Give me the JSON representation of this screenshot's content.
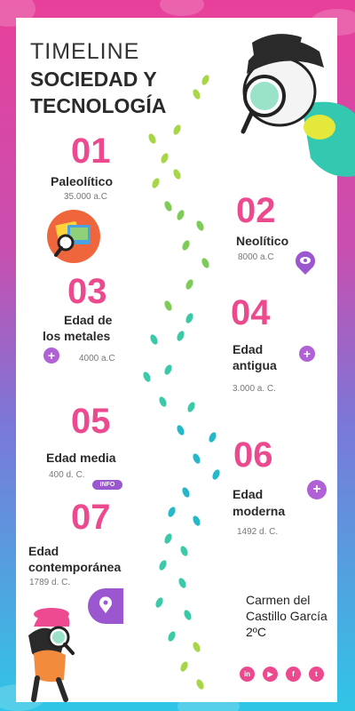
{
  "title": {
    "line1": "TIMELINE",
    "line2": "SOCIEDAD Y",
    "line3": "TECNOLOGÍA"
  },
  "items": [
    {
      "number": "01",
      "era": "Paleolítico",
      "date": "35.000 a.C"
    },
    {
      "number": "02",
      "era": "Neolítico",
      "date": "8000 a.C"
    },
    {
      "number": "03",
      "era_line1": "Edad de",
      "era_line2": "los metales",
      "date": "4000 a.C"
    },
    {
      "number": "04",
      "era_line1": "Edad",
      "era_line2": "antigua",
      "date": "3.000 a. C."
    },
    {
      "number": "05",
      "era": "Edad media",
      "date": "400 d. C."
    },
    {
      "number": "06",
      "era_line1": "Edad",
      "era_line2": "moderna",
      "date": "1492 d. C."
    },
    {
      "number": "07",
      "era_line1": "Edad",
      "era_line2": "contemporánea",
      "date": "1789 d. C."
    }
  ],
  "info_badge": "INFO",
  "plus_symbol": "+",
  "author": {
    "line1": "Carmen del",
    "line2": "Castillo García",
    "line3": "2ºC"
  },
  "social": [
    {
      "icon": "linkedin-icon",
      "glyph": "in"
    },
    {
      "icon": "youtube-icon",
      "glyph": "▶"
    },
    {
      "icon": "facebook-icon",
      "glyph": "f"
    },
    {
      "icon": "twitter-icon",
      "glyph": "t"
    }
  ],
  "colors": {
    "accent_pink": "#ec4a8f",
    "accent_purple": "#b061d6",
    "bg_top": "#e8409a",
    "bg_bottom": "#2fc6e6"
  }
}
